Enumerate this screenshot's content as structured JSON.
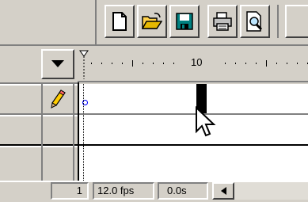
{
  "status_bar": {
    "current_frame": "1",
    "frame_rate": "12.0 fps",
    "elapsed_time": "0.0s",
    "scroll_left_label": "◄"
  },
  "timeline": {
    "ruler_label_10": "10"
  },
  "toolbar": {
    "buttons": [
      "new-file",
      "open-file",
      "save-file",
      "print",
      "print-preview"
    ]
  },
  "icons": {
    "layer_edit": "pencil-icon",
    "menu": "triangle-down-icon"
  }
}
